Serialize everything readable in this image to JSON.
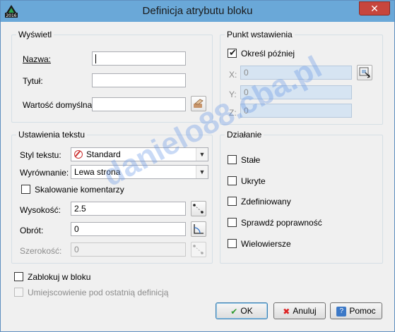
{
  "window": {
    "title": "Definicja atrybutu bloku",
    "close_label": "✕"
  },
  "display_group": {
    "label": "Wyświetl",
    "name_label": "Nazwa:",
    "name_value": "",
    "title_label": "Tytuł:",
    "title_value": "",
    "default_label": "Wartość domyślna:",
    "default_value": ""
  },
  "insert_group": {
    "label": "Punkt wstawienia",
    "specify_later_label": "Określ później",
    "specify_later_checked": true,
    "x_label": "X:",
    "x_value": "0",
    "y_label": "Y:",
    "y_value": "0",
    "z_label": "Z:",
    "z_value": "0"
  },
  "text_group": {
    "label": "Ustawienia tekstu",
    "style_label": "Styl tekstu:",
    "style_value": "Standard",
    "align_label": "Wyrównanie:",
    "align_value": "Lewa strona",
    "annotative_label": "Skalowanie komentarzy",
    "annotative_checked": false,
    "height_label": "Wysokość:",
    "height_value": "2.5",
    "rotation_label": "Obrót:",
    "rotation_value": "0",
    "width_label": "Szerokość:",
    "width_value": "0"
  },
  "mode_group": {
    "label": "Działanie",
    "options": [
      "Stałe",
      "Ukryte",
      "Zdefiniowany",
      "Sprawdź poprawność",
      "Wielowiersze"
    ]
  },
  "lock_label": "Zablokuj w bloku",
  "below_label": "Umiejscowienie pod ostatnią definicją",
  "buttons": {
    "ok": "OK",
    "cancel": "Anuluj",
    "help": "Pomoc"
  },
  "watermark": "danielo88.cba.pl",
  "app_badge": "2016",
  "colors": {
    "titlebar": "#6aa8d8",
    "dialog_bg": "#f0f0f0",
    "close": "#c7463d"
  }
}
